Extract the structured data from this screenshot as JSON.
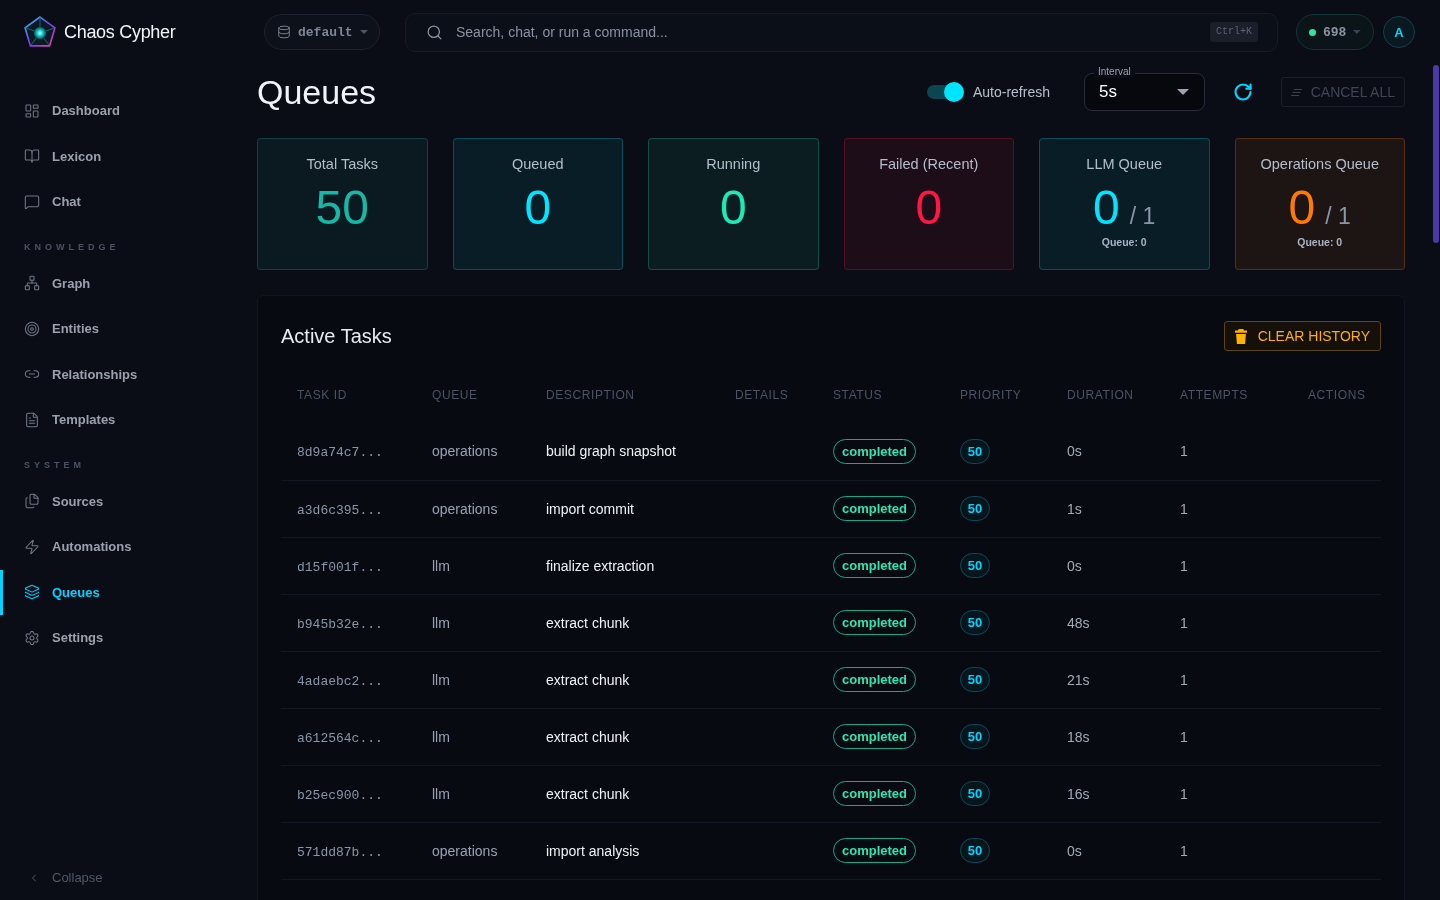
{
  "app": {
    "name": "Chaos Cypher"
  },
  "sidebar": {
    "sections": [
      {
        "items": [
          {
            "label": "Dashboard",
            "selected": false
          },
          {
            "label": "Lexicon",
            "selected": false
          },
          {
            "label": "Chat",
            "selected": false
          }
        ]
      },
      {
        "title": "KNOWLEDGE",
        "items": [
          {
            "label": "Graph",
            "selected": false
          },
          {
            "label": "Entities",
            "selected": false
          },
          {
            "label": "Relationships",
            "selected": false
          },
          {
            "label": "Templates",
            "selected": false
          }
        ]
      },
      {
        "title": "SYSTEM",
        "items": [
          {
            "label": "Sources",
            "selected": false
          },
          {
            "label": "Automations",
            "selected": false
          },
          {
            "label": "Queues",
            "selected": true
          },
          {
            "label": "Settings",
            "selected": false
          }
        ]
      }
    ],
    "collapse": "Collapse"
  },
  "topbar": {
    "workspace": "default",
    "search": {
      "placeholder": "Search, chat, or run a command...",
      "shortcut": "Ctrl+K"
    },
    "status": {
      "count": "698"
    },
    "avatar": "A"
  },
  "header": {
    "title": "Queues",
    "auto_refresh": {
      "label": "Auto-refresh",
      "on": true
    },
    "interval": {
      "label": "Interval",
      "value": "5s"
    },
    "cancel_all": {
      "label": "CANCEL ALL",
      "disabled": true
    }
  },
  "stats": [
    {
      "label": "Total Tasks",
      "value": "50",
      "color": "#14b8a6"
    },
    {
      "label": "Queued",
      "value": "0",
      "color": "#00e5ff"
    },
    {
      "label": "Running",
      "value": "0",
      "color": "#1de9b6"
    },
    {
      "label": "Failed (Recent)",
      "value": "0",
      "color": "#ff1744"
    },
    {
      "label": "LLM Queue",
      "value": "0",
      "capacity": "/ 1",
      "note": "Queue: 0",
      "color": "#00e5ff"
    },
    {
      "label": "Operations Queue",
      "value": "0",
      "capacity": "/ 1",
      "note": "Queue: 0",
      "color": "#ff7a00"
    }
  ],
  "tasks": {
    "title": "Active Tasks",
    "clear_button": "CLEAR HISTORY",
    "columns": [
      "TASK ID",
      "QUEUE",
      "DESCRIPTION",
      "DETAILS",
      "STATUS",
      "PRIORITY",
      "DURATION",
      "ATTEMPTS",
      "ACTIONS"
    ],
    "rows": [
      {
        "task_id": "8d9a74c7...",
        "queue": "operations",
        "description": "build graph snapshot",
        "status": "completed",
        "priority": "50",
        "duration": "0s",
        "attempts": "1"
      },
      {
        "task_id": "a3d6c395...",
        "queue": "operations",
        "description": "import commit",
        "status": "completed",
        "priority": "50",
        "duration": "1s",
        "attempts": "1"
      },
      {
        "task_id": "d15f001f...",
        "queue": "llm",
        "description": "finalize extraction",
        "status": "completed",
        "priority": "50",
        "duration": "0s",
        "attempts": "1"
      },
      {
        "task_id": "b945b32e...",
        "queue": "llm",
        "description": "extract chunk",
        "status": "completed",
        "priority": "50",
        "duration": "48s",
        "attempts": "1"
      },
      {
        "task_id": "4adaebc2...",
        "queue": "llm",
        "description": "extract chunk",
        "status": "completed",
        "priority": "50",
        "duration": "21s",
        "attempts": "1"
      },
      {
        "task_id": "a612564c...",
        "queue": "llm",
        "description": "extract chunk",
        "status": "completed",
        "priority": "50",
        "duration": "18s",
        "attempts": "1"
      },
      {
        "task_id": "b25ec900...",
        "queue": "llm",
        "description": "extract chunk",
        "status": "completed",
        "priority": "50",
        "duration": "16s",
        "attempts": "1"
      },
      {
        "task_id": "571dd87b...",
        "queue": "operations",
        "description": "import analysis",
        "status": "completed",
        "priority": "50",
        "duration": "0s",
        "attempts": "1"
      }
    ]
  }
}
